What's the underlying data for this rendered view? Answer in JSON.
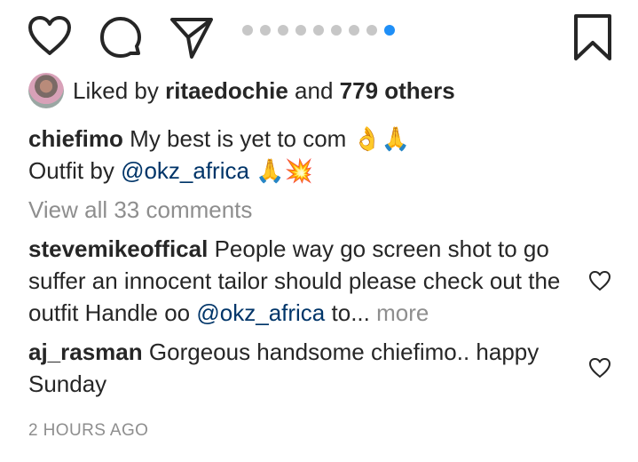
{
  "actions": {
    "like_icon": "heart-outline",
    "comment_icon": "speech-bubble",
    "share_icon": "paper-plane",
    "save_icon": "bookmark"
  },
  "carousel": {
    "total": 9,
    "active": 9,
    "active_color": "#1f8ff7",
    "inactive_color": "#c7c7c7"
  },
  "likes": {
    "prefix": "Liked by",
    "user": "ritaedochie",
    "conjunction": "and",
    "others": "779 others"
  },
  "caption": {
    "username": "chiefimo",
    "text": "My best is yet to com 👌🙏",
    "line2_prefix": "Outfit by",
    "mention": "@okz_africa",
    "line2_suffix": "🙏💥"
  },
  "view_all_comments": "View all 33 comments",
  "comments": [
    {
      "username": "stevemikeoffical",
      "text": "People way go screen shot to go suffer an innocent tailor should please check out the outfit Handle oo",
      "mention": "@okz_africa",
      "tail": "to...",
      "more": "more"
    },
    {
      "username": "aj_rasman",
      "text": "Gorgeous handsome chiefimo.. happy Sunday"
    }
  ],
  "timestamp": "2 HOURS AGO",
  "colors": {
    "text": "#262626",
    "muted": "#8e8e8e",
    "link": "#003569"
  }
}
